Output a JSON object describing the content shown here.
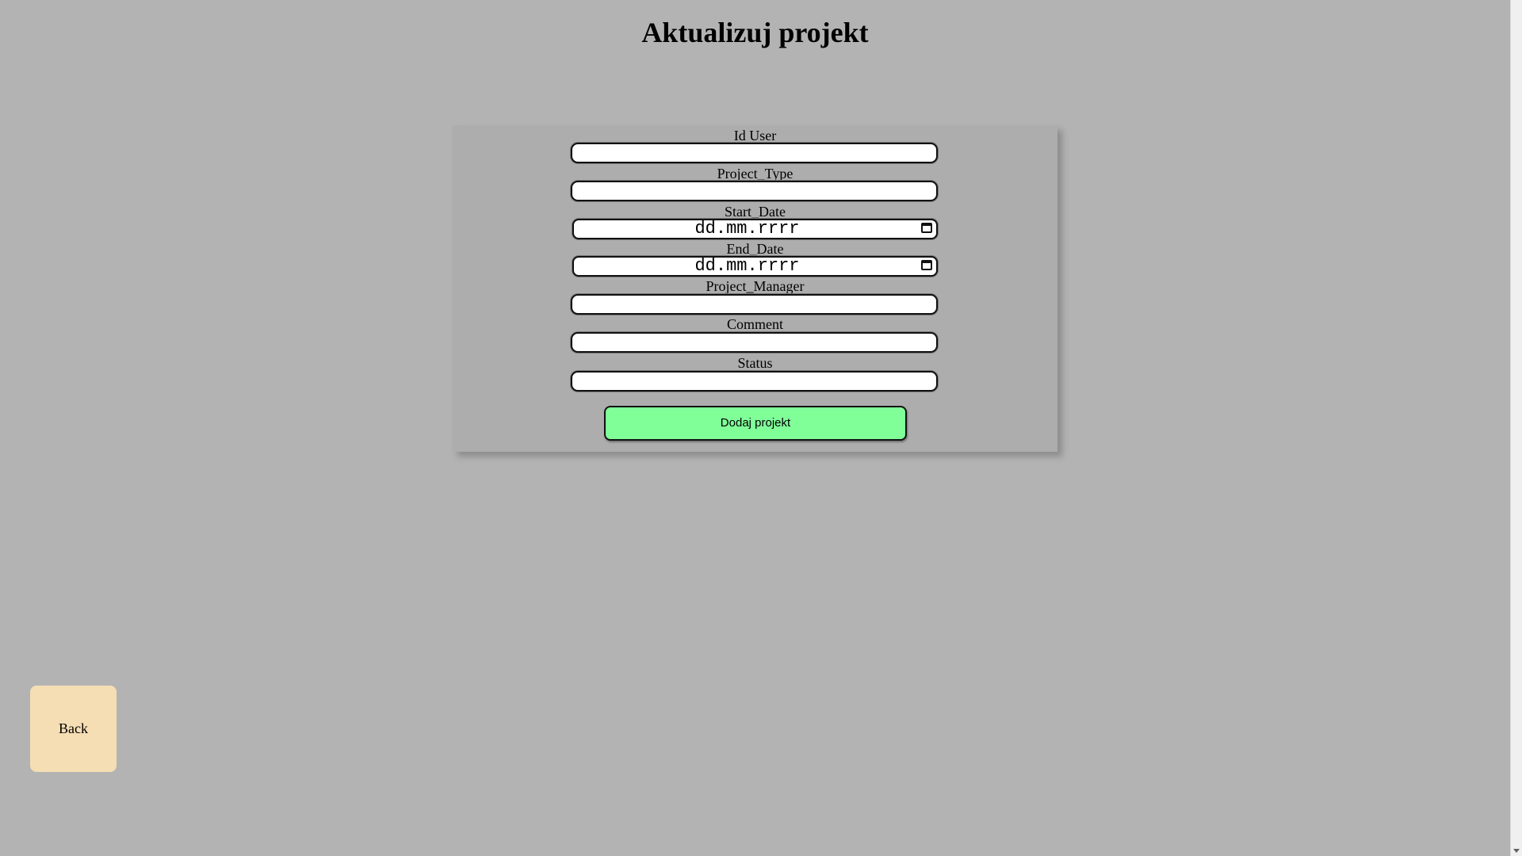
{
  "page": {
    "title": "Aktualizuj projekt"
  },
  "form": {
    "fields": [
      {
        "label": "Id User",
        "value": "",
        "type": "text"
      },
      {
        "label": "Project_Type",
        "value": "",
        "type": "text"
      },
      {
        "label": "Start_Date",
        "placeholder": "dd.mm.rrrr",
        "type": "date"
      },
      {
        "label": "End_Date",
        "placeholder": "dd.mm.rrrr",
        "type": "date"
      },
      {
        "label": "Project_Manager",
        "value": "",
        "type": "text"
      },
      {
        "label": "Comment",
        "value": "",
        "type": "text"
      },
      {
        "label": "Status",
        "value": "",
        "type": "text"
      }
    ],
    "submit_label": "Dodaj projekt"
  },
  "nav": {
    "back_label": "Back"
  },
  "colors": {
    "background": "#b3b3b3",
    "card": "#adadad",
    "submit": "#80ff99",
    "back": "#f5deb3"
  },
  "icons": {
    "date_picker": "calendar-icon"
  }
}
